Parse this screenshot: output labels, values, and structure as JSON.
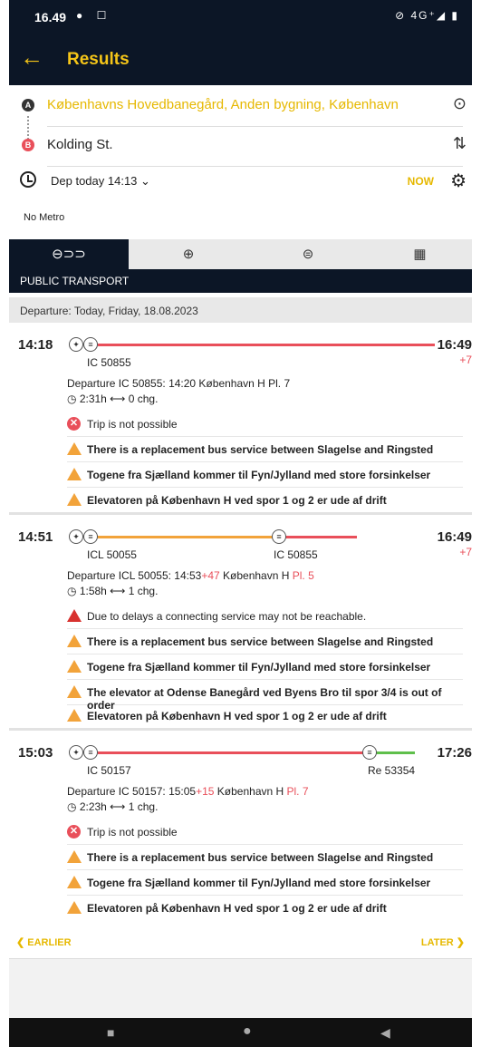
{
  "status": {
    "time": "16.49",
    "left_icons": "● ☐",
    "right_icons": "⊘ 4G⁺◢ ▮"
  },
  "appbar": {
    "back": "←",
    "title": "Results"
  },
  "search": {
    "from_pin": "A",
    "from": "Københavns Hovedbanegård, Anden bygning, København",
    "to_pin": "B",
    "to": "Kolding St.",
    "locate_icon": "⊙",
    "swap_icon": "⇅",
    "departure": "Dep today 14:13 ⌄",
    "now": "NOW",
    "settings_icon": "⚙",
    "filter": "No Metro"
  },
  "tabs": {
    "t1": "⊖⊃⊃",
    "t2": "⊕",
    "t3": "⊜",
    "t4": "▦",
    "active_label": "PUBLIC TRANSPORT"
  },
  "date_header": "Departure: Today, Friday, 18.08.2023",
  "trips": [
    {
      "dep": "14:18",
      "arr": "16:49",
      "delay": "+7",
      "labels": [
        "IC 50855"
      ],
      "detail_pre": "Departure IC 50855: 14:20 København H Pl. 7",
      "detail_delay": "",
      "detail_post": "",
      "detail_plat": "",
      "duration": "2:31h  ⟷ 0 chg.",
      "messages": [
        "Trip is not possible",
        "There is a replacement bus service between Slagelse and Ringsted",
        "Togene fra Sjælland kommer til Fyn/Jylland med store forsinkelser",
        "Elevatoren på København H ved spor 1 og 2 er ude af drift"
      ]
    },
    {
      "dep": "14:51",
      "arr": "16:49",
      "delay": "+7",
      "labels": [
        "ICL 50055",
        "IC 50855"
      ],
      "detail_pre": "Departure ICL 50055: 14:53",
      "detail_delay": "+47",
      "detail_post": " København H ",
      "detail_plat": "Pl. 5",
      "duration": "1:58h  ⟷ 1 chg.",
      "messages": [
        "Due to delays a connecting service may not be reachable.",
        "There is a replacement bus service between Slagelse and Ringsted",
        "Togene fra Sjælland kommer til Fyn/Jylland med store forsinkelser",
        "The elevator at Odense Banegård ved Byens Bro til spor 3/4 is out of order",
        "Elevatoren på København H ved spor 1 og 2 er ude af drift"
      ]
    },
    {
      "dep": "15:03",
      "arr": "17:26",
      "delay": "",
      "labels": [
        "IC 50157",
        "Re 53354"
      ],
      "detail_pre": "Departure IC 50157: 15:05",
      "detail_delay": "+15",
      "detail_post": " København H ",
      "detail_plat": "Pl. 7",
      "duration": "2:23h  ⟷ 1 chg.",
      "messages": [
        "Trip is not possible",
        "There is a replacement bus service between Slagelse and Ringsted",
        "Togene fra Sjælland kommer til Fyn/Jylland med store forsinkelser",
        "Elevatoren på København H ved spor 1 og 2 er ude af drift"
      ]
    }
  ],
  "pager": {
    "earlier": "❮  EARLIER",
    "later": "LATER  ❯"
  },
  "nav": {
    "recent": "■",
    "home": "●",
    "back": "◀"
  },
  "colors": {
    "brand_dark": "#0c1626",
    "accent": "#f5c518",
    "alert_red": "#e94f5a",
    "warning": "#f2a33a"
  }
}
